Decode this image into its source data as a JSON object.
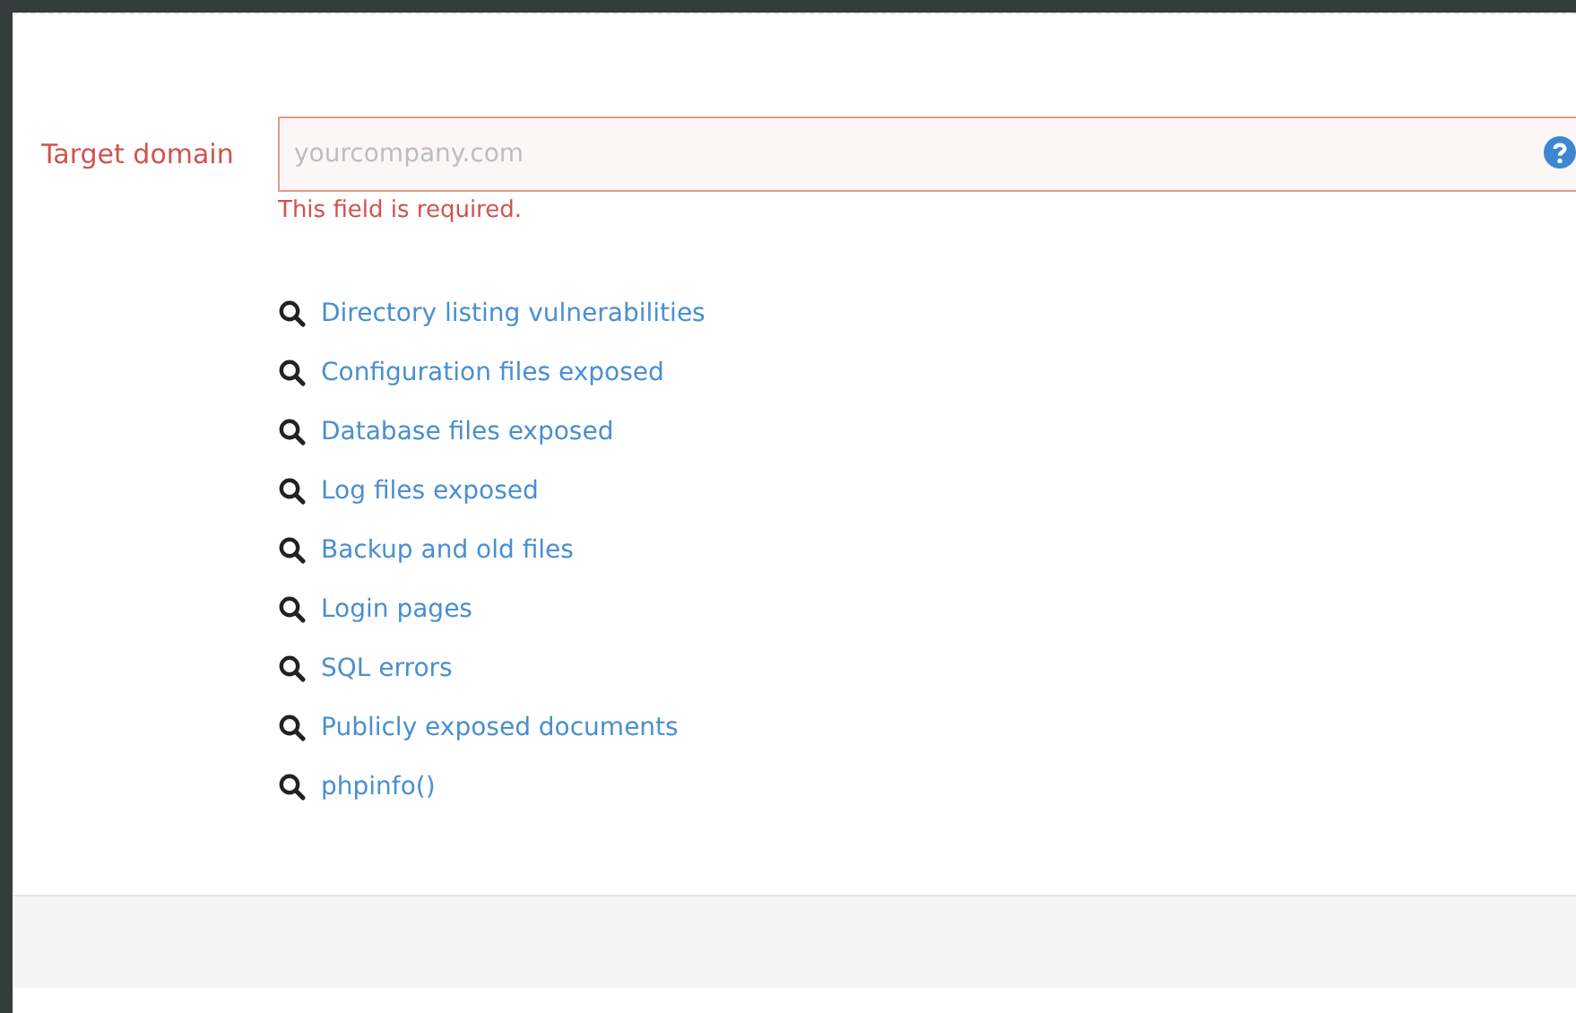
{
  "form": {
    "label": "Target domain",
    "placeholder": "yourcompany.com",
    "invalid": true,
    "error": "This field is required."
  },
  "links": [
    {
      "label": "Directory listing vulnerabilities"
    },
    {
      "label": "Configuration files exposed"
    },
    {
      "label": "Database files exposed"
    },
    {
      "label": "Log files exposed"
    },
    {
      "label": "Backup and old files"
    },
    {
      "label": "Login pages"
    },
    {
      "label": "SQL errors"
    },
    {
      "label": "Publicly exposed documents"
    },
    {
      "label": "phpinfo()"
    }
  ]
}
